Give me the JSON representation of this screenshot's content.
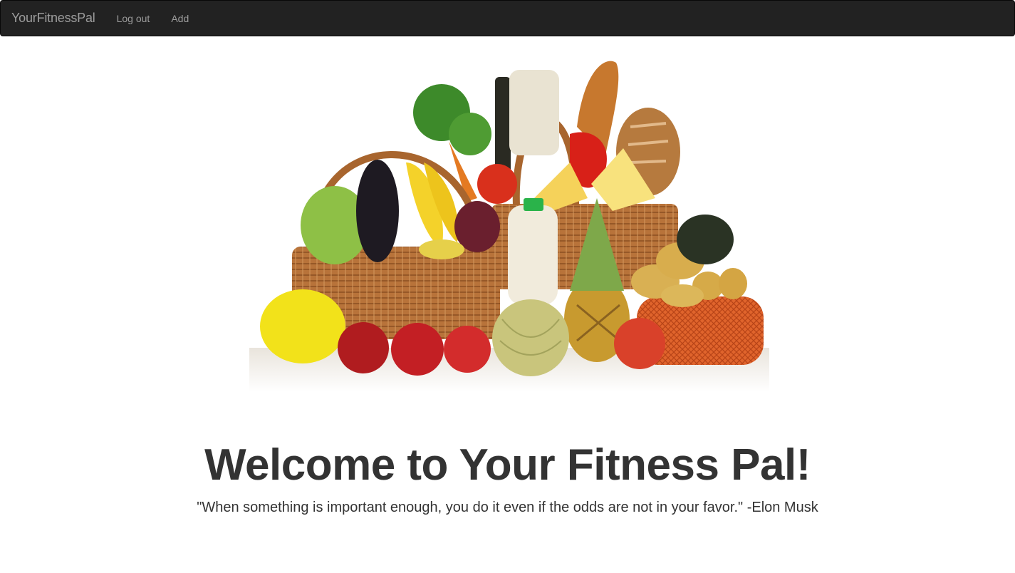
{
  "navbar": {
    "brand": "YourFitnessPal",
    "links": [
      "Log out",
      "Add"
    ]
  },
  "hero": {
    "image": "grocery-basket-image"
  },
  "main": {
    "title": "Welcome to Your Fitness Pal!",
    "quote": "\"When something is important enough, you do it even if the odds are not in your favor.\" -Elon Musk"
  },
  "colors": {
    "navbar_bg": "#222222",
    "nav_text": "#9d9d9d",
    "text": "#333333"
  }
}
